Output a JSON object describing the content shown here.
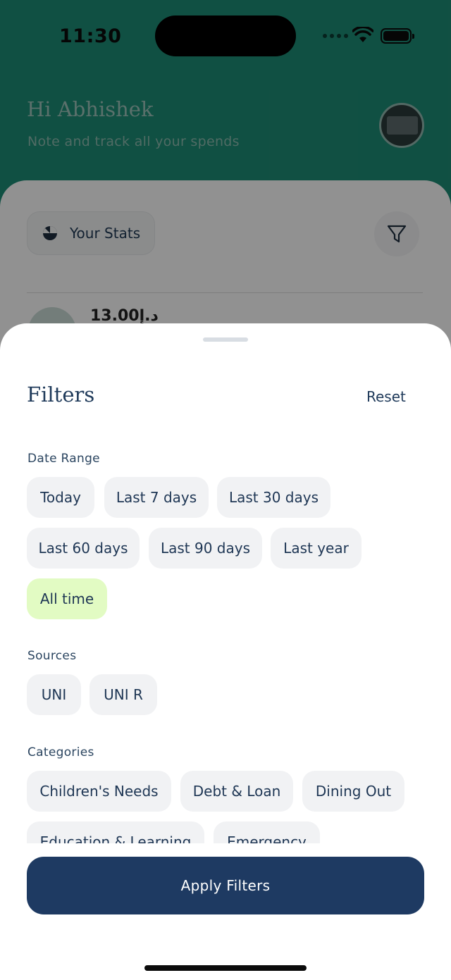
{
  "status_bar": {
    "time": "11:30"
  },
  "header": {
    "greeting": "Hi Abhishek",
    "subtitle": "Note and track all your spends"
  },
  "main": {
    "stats_button_label": "Your Stats",
    "peek_amount": "13.00د.إ"
  },
  "filters_sheet": {
    "title": "Filters",
    "reset_label": "Reset",
    "date_range": {
      "label": "Date Range",
      "options": [
        "Today",
        "Last 7 days",
        "Last 30 days",
        "Last 60 days",
        "Last 90 days",
        "Last year",
        "All time"
      ],
      "selected": "All time"
    },
    "sources": {
      "label": "Sources",
      "options": [
        "UNI",
        "UNI R"
      ]
    },
    "categories": {
      "label": "Categories",
      "options": [
        "Children's Needs",
        "Debt & Loan",
        "Dining Out",
        "Education & Learning",
        "Emergency"
      ]
    },
    "apply_label": "Apply Filters"
  },
  "colors": {
    "header_green": "#1d8a74",
    "navy": "#1e3a62",
    "chip_bg": "#f1f2f4",
    "chip_selected_bg": "#e2fbc3"
  },
  "icons": [
    "wifi-icon",
    "battery-icon",
    "pie-chart-icon",
    "filter-icon"
  ]
}
